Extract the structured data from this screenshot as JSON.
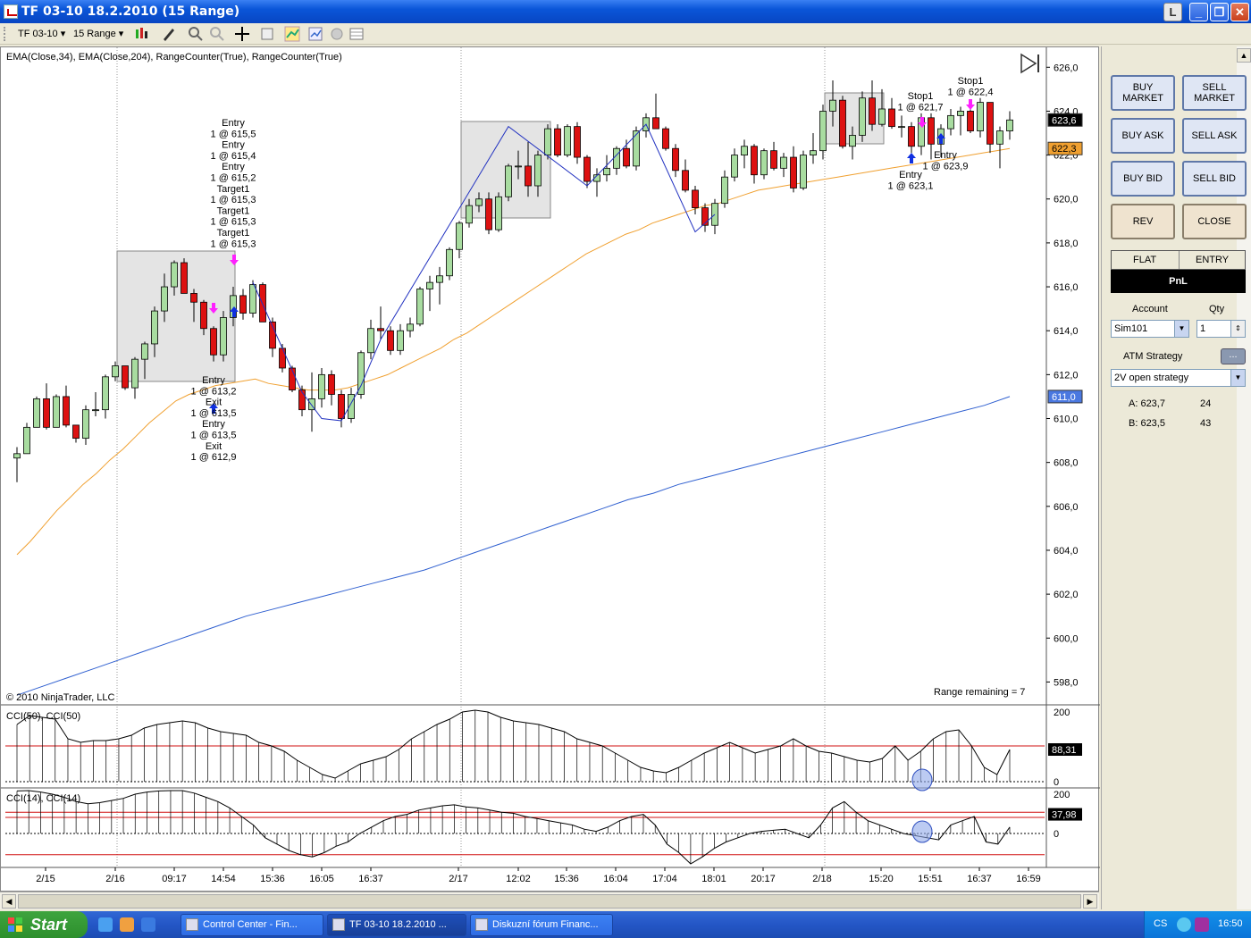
{
  "window": {
    "title": "TF 03-10  18.2.2010 (15 Range)"
  },
  "toolbar": {
    "instrument": "TF 03-10",
    "interval": "15 Range"
  },
  "chart": {
    "indicator_label": "EMA(Close,34), EMA(Close,204), RangeCounter(True), RangeCounter(True)",
    "copyright": "© 2010 NinjaTrader, LLC",
    "range_remaining": "Range remaining = 7",
    "price_ticks": [
      "626,0",
      "624,0",
      "622,0",
      "620,0",
      "618,0",
      "616,0",
      "614,0",
      "612,0",
      "610,0",
      "608,0",
      "606,0",
      "604,0",
      "602,0",
      "600,0",
      "598,0"
    ],
    "price_tags": {
      "last": "623,6",
      "ema34": "622,3",
      "ema204": "611,0"
    },
    "time_ticks": [
      "2/15",
      "2/16",
      "09:17",
      "14:54",
      "15:36",
      "16:05",
      "16:37",
      "2/17",
      "12:02",
      "15:36",
      "16:04",
      "17:04",
      "18:01",
      "20:17",
      "2/18",
      "15:20",
      "15:51",
      "16:37",
      "16:59"
    ],
    "annotations": {
      "top_group": [
        "Entry",
        "1 @ 615,5",
        "Entry",
        "1 @ 615,4",
        "Entry",
        "1 @ 615,2",
        "Target1",
        "1 @ 615,3",
        "Target1",
        "1 @ 615,3",
        "Target1",
        "1 @ 615,3"
      ],
      "bottom_group": [
        "Entry",
        "1 @ 613,2",
        "Exit",
        "1 @ 613,5",
        "Entry",
        "1 @ 613,5",
        "Exit",
        "1 @ 612,9"
      ],
      "stop1_a": [
        "Stop1",
        "1 @ 621,7"
      ],
      "stop1_b": [
        "Stop1",
        "1 @ 622,4"
      ],
      "entry_a": [
        "Entry",
        "1 @ 623,1"
      ],
      "entry_b": [
        "Entry",
        "1 @ 623,9"
      ]
    },
    "cci50": {
      "label": "CCI(50), CCI(50)",
      "ticks": [
        "200",
        "0"
      ],
      "value": "88,31"
    },
    "cci14": {
      "label": "CCI(14), CCI(14)",
      "ticks": [
        "200",
        "0"
      ],
      "value": "37,98"
    },
    "colors": {
      "up": "#a8dca0",
      "down": "#dd1111",
      "ema34": "#f0a030",
      "ema204": "#3060d0",
      "long_arrow": "#1030e0",
      "short_arrow": "#ff20ff"
    }
  },
  "chart_data": {
    "type": "candlestick",
    "ylabel": "",
    "ylim": [
      597,
      626.5
    ],
    "candles": [
      [
        608.2,
        608.7,
        607.1,
        608.4
      ],
      [
        608.4,
        609.8,
        608.4,
        609.6
      ],
      [
        609.6,
        611.0,
        609.6,
        610.9
      ],
      [
        610.9,
        611.6,
        609.5,
        609.6
      ],
      [
        609.6,
        611.1,
        609.6,
        611.0
      ],
      [
        611.0,
        611.5,
        609.6,
        609.7
      ],
      [
        609.7,
        609.7,
        608.9,
        609.1
      ],
      [
        609.1,
        610.6,
        608.8,
        610.4
      ],
      [
        610.4,
        611.2,
        610.1,
        610.4
      ],
      [
        610.4,
        612.0,
        610.0,
        611.9
      ],
      [
        611.9,
        612.6,
        611.7,
        612.4
      ],
      [
        612.4,
        612.4,
        611.3,
        611.4
      ],
      [
        611.4,
        612.8,
        610.9,
        612.7
      ],
      [
        612.7,
        613.5,
        611.8,
        613.4
      ],
      [
        613.4,
        615.1,
        612.8,
        614.9
      ],
      [
        614.9,
        616.6,
        614.4,
        616.0
      ],
      [
        616.0,
        617.2,
        615.6,
        617.1
      ],
      [
        617.1,
        617.3,
        615.7,
        615.7
      ],
      [
        615.7,
        615.9,
        614.4,
        615.3
      ],
      [
        615.3,
        615.4,
        613.8,
        614.1
      ],
      [
        614.1,
        614.2,
        612.6,
        612.9
      ],
      [
        612.9,
        614.9,
        612.6,
        614.6
      ],
      [
        614.6,
        616.0,
        614.2,
        615.6
      ],
      [
        615.6,
        615.9,
        614.5,
        614.8
      ],
      [
        614.8,
        616.3,
        614.6,
        616.1
      ],
      [
        616.1,
        616.2,
        614.4,
        614.4
      ],
      [
        614.4,
        614.6,
        612.8,
        613.2
      ],
      [
        613.2,
        613.4,
        612.1,
        612.3
      ],
      [
        612.3,
        612.4,
        611.2,
        611.3
      ],
      [
        611.3,
        611.5,
        610.1,
        610.4
      ],
      [
        610.4,
        612.1,
        609.4,
        610.9
      ],
      [
        610.9,
        612.3,
        610.5,
        612.0
      ],
      [
        612.0,
        612.2,
        610.6,
        611.1
      ],
      [
        611.1,
        611.3,
        609.6,
        610.0
      ],
      [
        610.0,
        611.4,
        609.8,
        611.1
      ],
      [
        611.1,
        613.1,
        610.9,
        613.0
      ],
      [
        613.0,
        614.5,
        612.7,
        614.1
      ],
      [
        614.1,
        615.1,
        613.6,
        614.0
      ],
      [
        614.0,
        614.2,
        612.9,
        613.1
      ],
      [
        613.1,
        614.3,
        612.9,
        614.0
      ],
      [
        614.0,
        614.6,
        613.7,
        614.3
      ],
      [
        614.3,
        616.0,
        614.2,
        615.9
      ],
      [
        615.9,
        616.5,
        614.9,
        616.2
      ],
      [
        616.2,
        616.9,
        615.2,
        616.5
      ],
      [
        616.5,
        617.8,
        616.3,
        617.7
      ],
      [
        617.7,
        619.0,
        617.3,
        618.9
      ],
      [
        618.9,
        620.0,
        618.7,
        619.7
      ],
      [
        619.7,
        620.3,
        619.4,
        620.0
      ],
      [
        620.0,
        620.3,
        618.4,
        618.6
      ],
      [
        618.6,
        620.3,
        618.5,
        620.1
      ],
      [
        620.1,
        621.6,
        619.9,
        621.5
      ],
      [
        621.5,
        622.2,
        620.9,
        621.5
      ],
      [
        621.5,
        622.6,
        620.1,
        620.6
      ],
      [
        620.6,
        622.2,
        620.1,
        622.0
      ],
      [
        622.0,
        623.4,
        621.8,
        623.2
      ],
      [
        623.2,
        623.4,
        621.9,
        622.0
      ],
      [
        622.0,
        623.4,
        621.9,
        623.3
      ],
      [
        623.3,
        623.5,
        621.6,
        621.9
      ],
      [
        621.9,
        622.0,
        620.5,
        620.8
      ],
      [
        620.8,
        621.4,
        620.1,
        621.1
      ],
      [
        621.1,
        622.0,
        620.8,
        621.4
      ],
      [
        621.4,
        622.4,
        621.1,
        622.3
      ],
      [
        622.3,
        622.7,
        621.4,
        621.5
      ],
      [
        621.5,
        623.3,
        621.3,
        623.1
      ],
      [
        623.1,
        623.9,
        622.8,
        623.7
      ],
      [
        623.7,
        624.8,
        623.4,
        623.2
      ],
      [
        623.2,
        623.3,
        622.2,
        622.3
      ],
      [
        622.3,
        622.5,
        621.0,
        621.3
      ],
      [
        621.3,
        621.8,
        620.3,
        620.4
      ],
      [
        620.4,
        620.6,
        619.3,
        619.6
      ],
      [
        619.6,
        619.8,
        618.5,
        618.8
      ],
      [
        618.8,
        620.0,
        618.4,
        619.8
      ],
      [
        619.8,
        621.3,
        619.6,
        621.0
      ],
      [
        621.0,
        622.3,
        620.8,
        622.0
      ],
      [
        622.0,
        622.7,
        621.4,
        622.4
      ],
      [
        622.4,
        622.5,
        620.7,
        621.1
      ],
      [
        621.1,
        622.3,
        620.9,
        622.2
      ],
      [
        622.2,
        622.6,
        621.3,
        621.4
      ],
      [
        621.4,
        622.1,
        621.0,
        621.9
      ],
      [
        621.9,
        622.4,
        620.3,
        620.5
      ],
      [
        620.5,
        622.2,
        620.4,
        622.0
      ],
      [
        622.0,
        623.0,
        621.6,
        622.2
      ],
      [
        622.2,
        624.3,
        621.8,
        624.0
      ],
      [
        624.0,
        625.4,
        623.3,
        624.5
      ],
      [
        624.5,
        624.7,
        622.3,
        622.4
      ],
      [
        622.4,
        623.3,
        621.8,
        622.9
      ],
      [
        622.9,
        624.9,
        622.6,
        624.6
      ],
      [
        624.6,
        625.4,
        623.1,
        623.4
      ],
      [
        623.4,
        625.0,
        623.3,
        624.1
      ],
      [
        624.1,
        624.6,
        623.2,
        623.3
      ],
      [
        623.3,
        623.8,
        622.8,
        623.3
      ],
      [
        623.3,
        623.5,
        622.1,
        622.4
      ],
      [
        622.4,
        623.9,
        622.0,
        623.7
      ],
      [
        623.7,
        623.9,
        621.8,
        622.5
      ],
      [
        622.5,
        623.4,
        621.9,
        623.2
      ],
      [
        623.2,
        624.1,
        622.9,
        623.8
      ],
      [
        623.8,
        624.2,
        622.9,
        624.0
      ],
      [
        624.0,
        624.3,
        623.0,
        623.1
      ],
      [
        623.1,
        624.6,
        622.8,
        624.4
      ],
      [
        624.4,
        624.4,
        622.1,
        622.5
      ],
      [
        622.5,
        623.3,
        621.4,
        623.1
      ],
      [
        623.1,
        624.0,
        622.7,
        623.6
      ]
    ],
    "series": [
      {
        "name": "EMA(Close,34)",
        "values": [
          603.8,
          604.4,
          605.1,
          605.8,
          606.4,
          607.0,
          607.5,
          608.1,
          608.6,
          609.2,
          609.8,
          610.3,
          610.8,
          611.1,
          611.3,
          611.5,
          611.6,
          611.7,
          611.8,
          611.6,
          611.5,
          611.4,
          611.3,
          611.3,
          611.3,
          611.4,
          611.6,
          611.8,
          612.0,
          612.3,
          612.6,
          612.9,
          613.2,
          613.6,
          613.9,
          614.3,
          614.7,
          615.1,
          615.5,
          615.9,
          616.3,
          616.7,
          617.1,
          617.5,
          617.8,
          618.1,
          618.4,
          618.6,
          618.9,
          619.1,
          619.3,
          619.5,
          619.7,
          619.8,
          620.0,
          620.2,
          620.4,
          620.5,
          620.6,
          620.7,
          620.8,
          620.9,
          621.0,
          621.1,
          621.2,
          621.3,
          621.4,
          621.5,
          621.6,
          621.7,
          621.8,
          621.9,
          622.0,
          622.1,
          622.2,
          622.3
        ]
      },
      {
        "name": "EMA(Close,204)",
        "values": [
          597.4,
          597.8,
          598.2,
          598.6,
          599.0,
          599.4,
          599.8,
          600.2,
          600.6,
          601.0,
          601.3,
          601.6,
          601.9,
          602.2,
          602.5,
          602.8,
          603.1,
          603.5,
          603.9,
          604.3,
          604.7,
          605.1,
          605.5,
          605.9,
          606.3,
          606.6,
          607.0,
          607.3,
          607.6,
          607.9,
          608.2,
          608.5,
          608.8,
          609.1,
          609.4,
          609.7,
          610.0,
          610.3,
          610.6,
          611.0
        ]
      }
    ],
    "cci50": [
      160,
      185,
      180,
      175,
      120,
      110,
      115,
      115,
      120,
      130,
      150,
      160,
      165,
      170,
      165,
      150,
      140,
      135,
      130,
      110,
      100,
      85,
      60,
      40,
      20,
      10,
      30,
      50,
      60,
      70,
      90,
      120,
      140,
      160,
      175,
      195,
      200,
      195,
      180,
      170,
      165,
      160,
      150,
      140,
      120,
      110,
      100,
      80,
      60,
      40,
      30,
      25,
      40,
      60,
      80,
      95,
      110,
      95,
      80,
      90,
      100,
      120,
      100,
      85,
      80,
      70,
      60,
      55,
      65,
      100,
      60,
      85,
      120,
      140,
      145,
      100,
      40,
      20,
      90
    ],
    "cci14": [
      200,
      205,
      195,
      185,
      170,
      150,
      140,
      145,
      155,
      165,
      185,
      195,
      200,
      210,
      205,
      190,
      170,
      150,
      120,
      80,
      40,
      -20,
      -50,
      -80,
      -100,
      -110,
      -90,
      -60,
      -40,
      0,
      30,
      60,
      80,
      90,
      110,
      120,
      130,
      135,
      125,
      120,
      110,
      100,
      95,
      80,
      70,
      60,
      50,
      40,
      20,
      10,
      30,
      60,
      80,
      90,
      40,
      -50,
      -90,
      -150,
      -110,
      -70,
      -40,
      -20,
      0,
      10,
      15,
      20,
      0,
      -20,
      40,
      120,
      150,
      100,
      60,
      40,
      20,
      0,
      -10,
      -20,
      -30,
      40,
      60,
      80,
      -40,
      -50,
      30
    ]
  }
}
